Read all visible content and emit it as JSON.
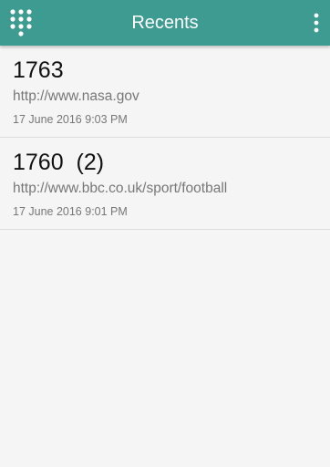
{
  "app": {
    "title": "Recents",
    "accent_color": "#3d9b92",
    "left_icon": "dialpad-icon",
    "right_icon": "more-vert-icon"
  },
  "recents": [
    {
      "number": "1763",
      "url": "http://www.nasa.gov",
      "timestamp": "17 June 2016 9:03 PM"
    },
    {
      "number": "1760  (2)",
      "url": "http://www.bbc.co.uk/sport/football",
      "timestamp": "17 June 2016 9:01 PM"
    }
  ]
}
